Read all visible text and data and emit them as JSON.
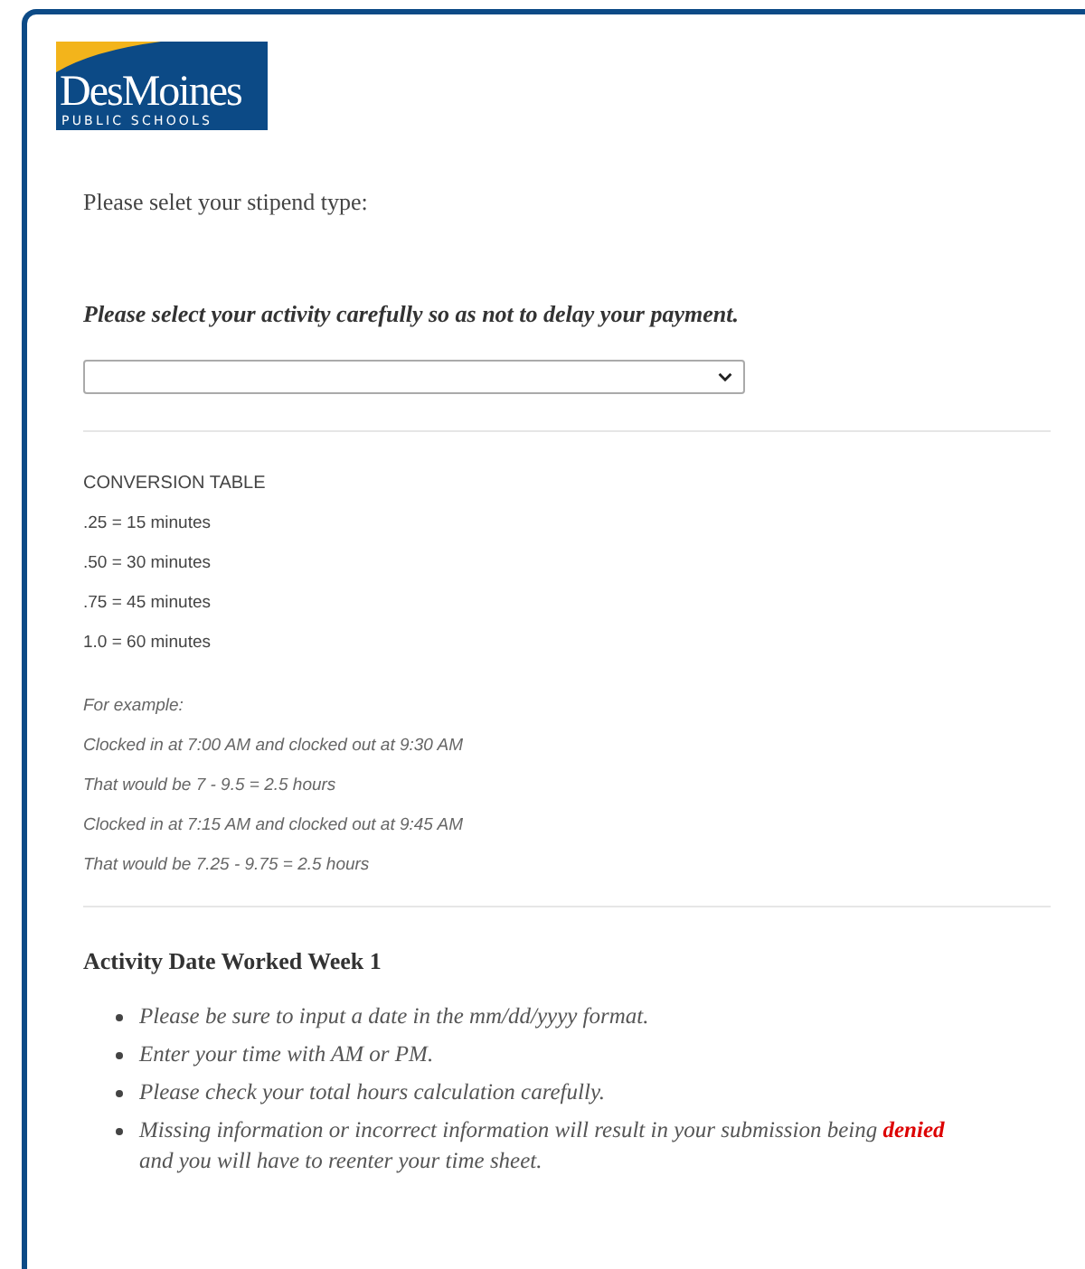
{
  "logo": {
    "name": "DesMoines",
    "subtitle": "PUBLIC SCHOOLS"
  },
  "stipend_prompt": "Please selet your stipend type:",
  "activity_notice": "Please select your activity carefully so as not to delay your payment.",
  "conversion": {
    "title": "CONVERSION TABLE",
    "rows": [
      ".25 = 15 minutes",
      ".50 = 30 minutes",
      ".75 = 45 minutes",
      "1.0 = 60 minutes"
    ]
  },
  "example": {
    "title": "For example:",
    "lines": [
      "Clocked in at 7:00 AM and clocked out at 9:30 AM",
      "That would be 7 - 9.5 = 2.5 hours",
      "Clocked in at 7:15 AM and clocked out at 9:45 AM",
      "That would be 7.25 - 9.75 = 2.5 hours"
    ]
  },
  "section": {
    "title": "Activity Date Worked Week 1",
    "bullets": [
      "Please be sure to input a date in the mm/dd/yyyy format.",
      "Enter your time with AM or PM.",
      "Please check your total hours calculation carefully.",
      "Missing information or incorrect information will result in your submission being **denied** and you will have to reenter your time sheet."
    ]
  }
}
